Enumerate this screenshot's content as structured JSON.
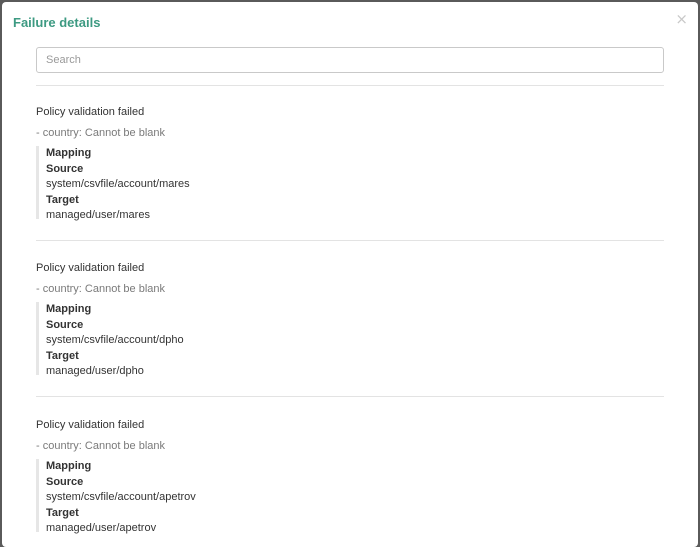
{
  "modal": {
    "title": "Failure details",
    "close_label": "×"
  },
  "search": {
    "placeholder": "Search",
    "value": ""
  },
  "failures": [
    {
      "title": "Policy validation failed",
      "message": "- country: Cannot be blank",
      "mapping_label": "Mapping",
      "source_label": "Source",
      "source": "system/csvfile/account/mares",
      "target_label": "Target",
      "target": "managed/user/mares"
    },
    {
      "title": "Policy validation failed",
      "message": "- country: Cannot be blank",
      "mapping_label": "Mapping",
      "source_label": "Source",
      "source": "system/csvfile/account/dpho",
      "target_label": "Target",
      "target": "managed/user/dpho"
    },
    {
      "title": "Policy validation failed",
      "message": "- country: Cannot be blank",
      "mapping_label": "Mapping",
      "source_label": "Source",
      "source": "system/csvfile/account/apetrov",
      "target_label": "Target",
      "target": "managed/user/apetrov"
    }
  ]
}
